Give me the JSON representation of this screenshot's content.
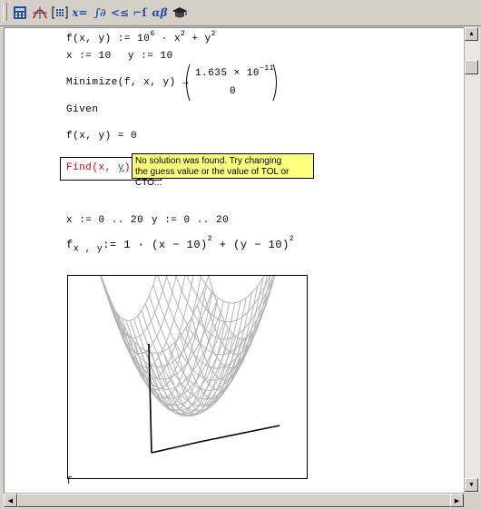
{
  "toolbar": {
    "buttons": [
      {
        "name": "calculator-button",
        "glyph": "▦"
      },
      {
        "name": "graph-button",
        "glyph": "⁄"
      },
      {
        "name": "matrix-button",
        "glyph": "[:::]"
      },
      {
        "name": "evaluation-button",
        "glyph": "x="
      },
      {
        "name": "calculus-button",
        "glyph": "∫∂"
      },
      {
        "name": "boolean-button",
        "glyph": "<≤"
      },
      {
        "name": "programming-button",
        "glyph": "⌐ſ"
      },
      {
        "name": "greek-button",
        "glyph": "αβ"
      },
      {
        "name": "symbolic-button",
        "glyph": "🎓"
      }
    ]
  },
  "worksheet": {
    "line1": {
      "lhs": "f(x, y) := 10",
      "exp1": "6",
      "mid": " · x",
      "exp2": "2",
      "tail": " + y",
      "exp3": "2"
    },
    "line2": {
      "x": "x := 10",
      "y": "y := 10"
    },
    "line3": {
      "lhs": "Minimize(f, x, y) →",
      "vec_top": "1.635 × 10",
      "vec_top_exp": "−11",
      "vec_bottom": "0"
    },
    "line4": "Given",
    "line5": "f(x, y) = 0",
    "line6": {
      "text": "Find(x, ",
      "var": "y",
      "tail": ") = ■ ■"
    },
    "tooltip": {
      "line1": "No solution was found. Try changing",
      "line2": "the guess value or the value of TOL or CTO..."
    },
    "line7": {
      "x": "x := 0 .. 20",
      "y": "y := 0 .. 20"
    },
    "line8": {
      "lhs": "f",
      "sub": "x , y",
      "rhs": ":= 1 · (x − 10)",
      "exp1": "2",
      "mid": " + (y − 10)",
      "exp2": "2"
    },
    "caption": "f"
  },
  "colors": {
    "error_red": "#cc0000",
    "tooltip_bg": "#ffff80"
  }
}
